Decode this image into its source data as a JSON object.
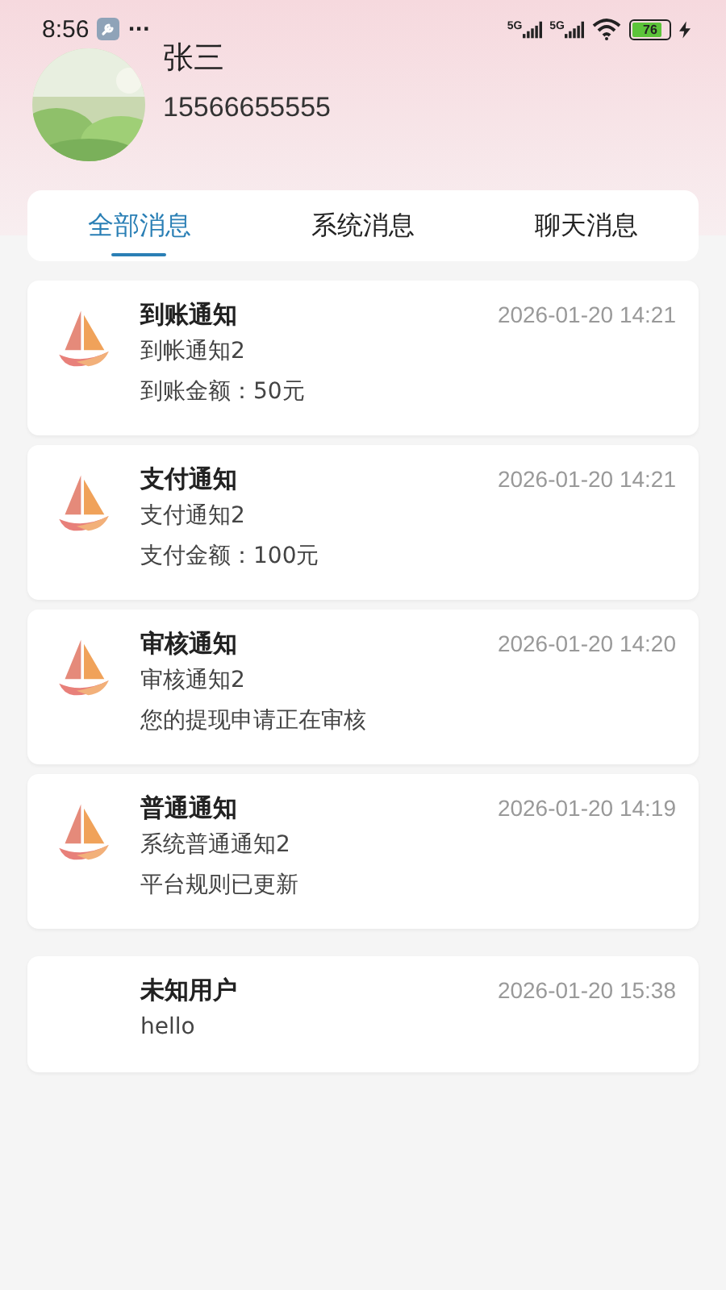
{
  "status_bar": {
    "time": "8:56",
    "more": "···",
    "networks": [
      "5G",
      "5G"
    ],
    "battery": "76",
    "charging": true
  },
  "profile": {
    "name": "张三",
    "phone": "15566655555"
  },
  "tabs": [
    {
      "label": "全部消息",
      "selected": true
    },
    {
      "label": "系统消息",
      "selected": false
    },
    {
      "label": "聊天消息",
      "selected": false
    }
  ],
  "notifications": [
    {
      "kind": "system",
      "title": "到账通知",
      "time": "2026-01-20 14:21",
      "lines": [
        "到帐通知2",
        "到账金额：50元"
      ]
    },
    {
      "kind": "system",
      "title": "支付通知",
      "time": "2026-01-20 14:21",
      "lines": [
        "支付通知2",
        "支付金额：100元"
      ]
    },
    {
      "kind": "system",
      "title": "审核通知",
      "time": "2026-01-20 14:20",
      "lines": [
        "审核通知2",
        "您的提现申请正在审核"
      ]
    },
    {
      "kind": "system",
      "title": "普通通知",
      "time": "2026-01-20 14:19",
      "lines": [
        "系统普通通知2",
        "平台规则已更新"
      ]
    },
    {
      "kind": "chat",
      "title": "未知用户",
      "time": "2026-01-20 15:38",
      "lines": [
        "hello"
      ]
    }
  ]
}
